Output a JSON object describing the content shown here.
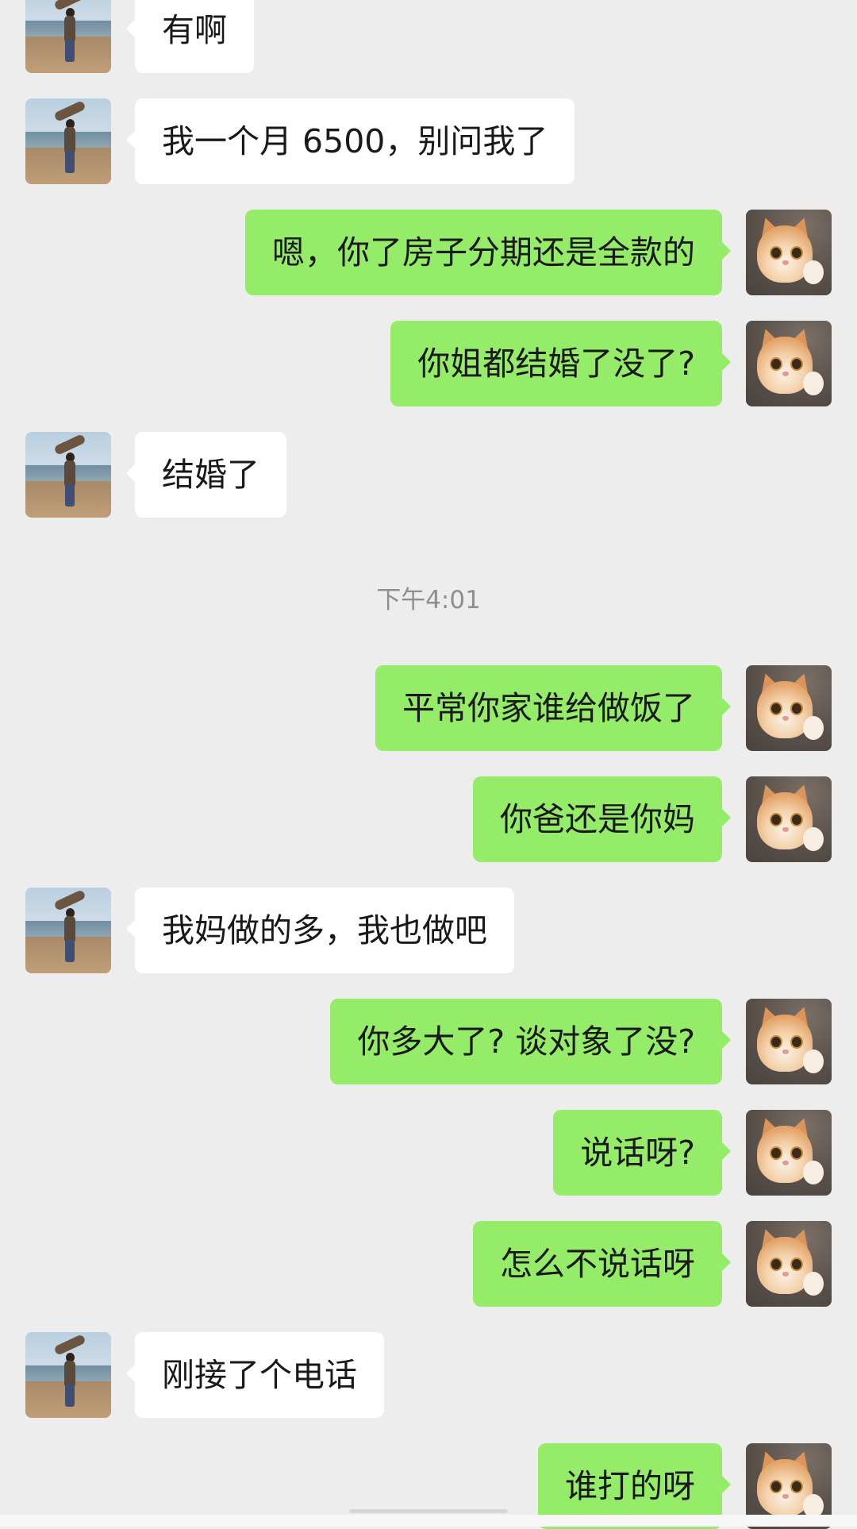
{
  "chat": {
    "messages": [
      {
        "side": "in",
        "text": "有啊"
      },
      {
        "side": "in",
        "text": "我一个月 6500，别问我了"
      },
      {
        "side": "out",
        "text": "嗯，你了房子分期还是全款的"
      },
      {
        "side": "out",
        "text": "你姐都结婚了没了?"
      },
      {
        "side": "in",
        "text": "结婚了"
      },
      {
        "side": "out",
        "text": "平常你家谁给做饭了"
      },
      {
        "side": "out",
        "text": "你爸还是你妈"
      },
      {
        "side": "in",
        "text": "我妈做的多，我也做吧"
      },
      {
        "side": "out",
        "text": "你多大了? 谈对象了没?"
      },
      {
        "side": "out",
        "text": "说话呀?"
      },
      {
        "side": "out",
        "text": "怎么不说话呀"
      },
      {
        "side": "in",
        "text": "刚接了个电话"
      },
      {
        "side": "out",
        "text": "谁打的呀"
      }
    ],
    "timestamp": "下午4:01",
    "colors": {
      "background": "#ededed",
      "incoming_bubble": "#ffffff",
      "outgoing_bubble": "#95ec69",
      "text": "#191919",
      "timestamp": "#8f8f8f"
    },
    "avatars": {
      "friend": "seaside-person-photo",
      "me": "orange-cat-photo"
    }
  }
}
